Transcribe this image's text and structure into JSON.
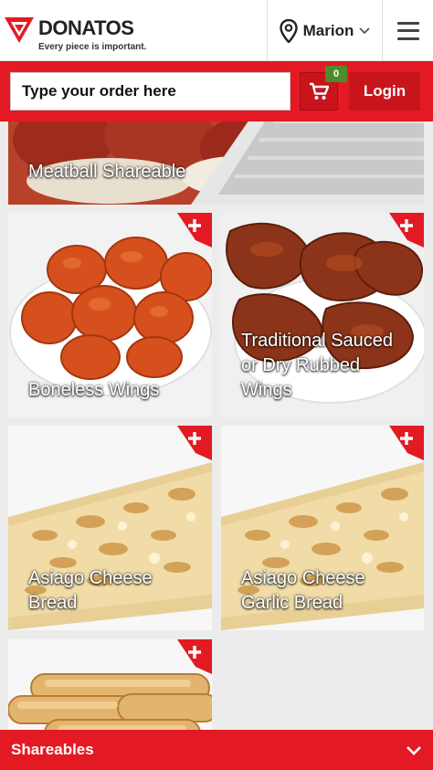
{
  "brand": {
    "name": "DONATOS",
    "tagline": "Every piece is important."
  },
  "location": {
    "label": "Marion"
  },
  "search": {
    "placeholder": "Type your order here"
  },
  "cart": {
    "count": "0"
  },
  "login": {
    "label": "Login"
  },
  "products": [
    {
      "name": "Meatball Shareable"
    },
    {
      "name": "Boneless Wings"
    },
    {
      "name": "Traditional Sauced\nor Dry Rubbed\nWings"
    },
    {
      "name": "Asiago Cheese\nBread"
    },
    {
      "name": "Asiago Cheese\nGarlic Bread"
    },
    {
      "name": ""
    }
  ],
  "category": {
    "label": "Shareables"
  },
  "colors": {
    "brand_red": "#e31a23",
    "dark_red": "#c8141b",
    "badge_green": "#4d8b2b"
  }
}
